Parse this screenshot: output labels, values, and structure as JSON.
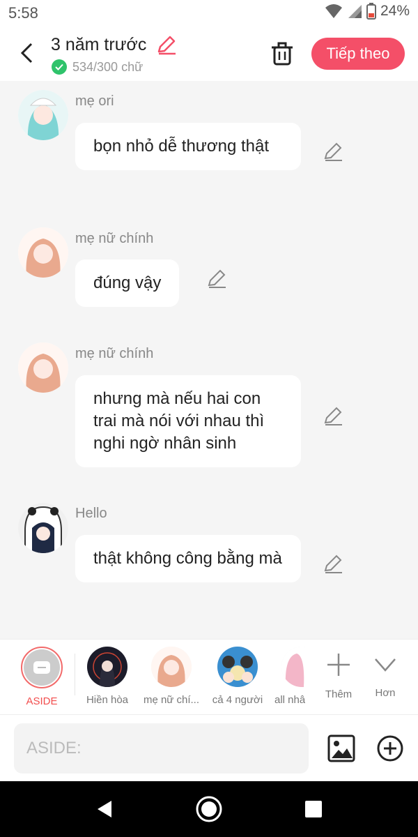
{
  "status": {
    "time": "5:58",
    "battery": "24%"
  },
  "header": {
    "title": "3 năm trước",
    "word_count": "534/300 chữ",
    "next_label": "Tiếp theo"
  },
  "messages": [
    {
      "sender": "mẹ ori",
      "text": "bọn nhỏ dễ thương thật"
    },
    {
      "sender": "mẹ nữ chính",
      "text": "đúng vậy"
    },
    {
      "sender": "mẹ nữ chính",
      "text": "nhưng mà nếu hai con trai mà nói với nhau thì nghi ngờ nhân sinh"
    },
    {
      "sender": "Hello",
      "text": "thật không công bằng mà"
    }
  ],
  "characters": [
    {
      "name": "ASIDE",
      "color": "#f24d4d"
    },
    {
      "name": "Hiền hòa"
    },
    {
      "name": "mẹ nữ chí..."
    },
    {
      "name": "cả 4 người"
    },
    {
      "name": "all nhâ"
    }
  ],
  "char_actions": {
    "more_label": "Thêm",
    "extra_label": "Hơn"
  },
  "input": {
    "placeholder": "ASIDE:"
  },
  "colors": {
    "accent": "#f44f68",
    "check": "#2fc36b"
  }
}
